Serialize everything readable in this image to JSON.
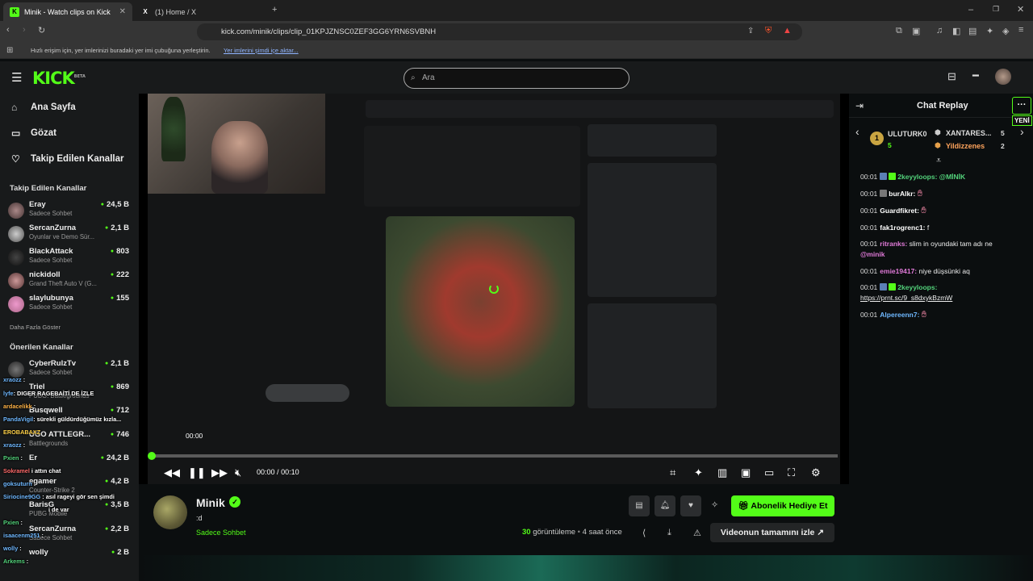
{
  "browser": {
    "tabs": [
      {
        "title": "Minik - Watch clips on Kick",
        "favicon": "K"
      },
      {
        "title": "(1) Home / X",
        "favicon": "X"
      }
    ],
    "url": "kick.com/minik/clips/clip_01KPJZNSC0ZEF3GG6YRN6SVBNH",
    "bookmark_hint": "Hızlı erişim için, yer imlerinizi buradaki yer imi çubuğuna yerleştirin.",
    "bookmark_link": "Yer imlerini şimdi içe aktar..."
  },
  "header": {
    "logo": "KICK",
    "logo_badge": "BETA",
    "search_placeholder": "Ara"
  },
  "sidebar": {
    "nav": [
      {
        "label": "Ana Sayfa",
        "icon": "home-icon"
      },
      {
        "label": "Gözat",
        "icon": "browse-icon"
      },
      {
        "label": "Takip Edilen Kanallar",
        "icon": "heart-icon"
      }
    ],
    "followed_header": "Takip Edilen Kanallar",
    "followed": [
      {
        "name": "Eray",
        "sub": "Sadece Sohbet",
        "count": "24,5 B"
      },
      {
        "name": "SercanZurna",
        "sub": "Oyunlar ve Demo Sür...",
        "count": "2,1 B"
      },
      {
        "name": "BlackAttack",
        "sub": "Sadece Sohbet",
        "count": "803"
      },
      {
        "name": "nickidoll",
        "sub": "Grand Theft Auto V (G...",
        "count": "222"
      },
      {
        "name": "slaylubunya",
        "sub": "Sadece Sohbet",
        "count": "155"
      }
    ],
    "show_more": "Daha Fazla Göster",
    "recommended_header": "Önerilen Kanallar",
    "recommended": [
      {
        "name": "CyberRulzTv",
        "sub": "Sadece Sohbet",
        "count": "2,1 B"
      },
      {
        "name": "Triel",
        "sub": "PUBG: Battlegrounds",
        "count": "869"
      },
      {
        "name": "Busqwell",
        "sub": "",
        "count": "712"
      },
      {
        "name": "UGO ATTLEGR...",
        "sub": "Battlegrounds",
        "count": "746"
      },
      {
        "name": "Er",
        "sub": "",
        "count": "24,2 B"
      },
      {
        "name": "egamer",
        "sub": "Counter-Strike 2",
        "count": "4,2 B"
      },
      {
        "name": "BarisG",
        "sub": "PUBG Mobile",
        "count": "3,5 B"
      },
      {
        "name": "SercanZurna",
        "sub": "Sadece Sohbet",
        "count": "2,2 B"
      },
      {
        "name": "wolly",
        "sub": "",
        "count": "2 B"
      }
    ]
  },
  "overlay_chat": [
    {
      "user": "xraozz",
      "text": ""
    },
    {
      "user": "lyfe",
      "text": "DIGER RAGEBAİTİ DE İZLE"
    },
    {
      "user": "ardacelikk",
      "text": ""
    },
    {
      "user": "PandaVigil",
      "text": "sürekli güldürdüğümüz kızla..."
    },
    {
      "user": "EROBABAXZ",
      "text": ""
    },
    {
      "user": "xraozz",
      "text": ""
    },
    {
      "user": "Pxien",
      "text": ""
    },
    {
      "user": "Sokramel",
      "text": "i attın chat"
    },
    {
      "user": "goksuturn",
      "text": ""
    },
    {
      "user": "Siriocine9GG",
      "text": "asıl rageyi gör sen şimdi"
    },
    {
      "user": "",
      "text": "i de var"
    },
    {
      "user": "Pxien",
      "text": ""
    },
    {
      "user": "isaacenm251",
      "text": ""
    },
    {
      "user": "wolly",
      "text": ""
    },
    {
      "user": "Arkems",
      "text": ""
    }
  ],
  "player": {
    "hover_time": "00:00",
    "current": "00:00",
    "separator": "/",
    "duration": "00:10",
    "progress_fraction": 0.0
  },
  "channel": {
    "name": "Minik",
    "clip_title": ":d",
    "category": "Sadece Sohbet",
    "gift_button": "Abonelik Hediye Et",
    "views_count": "30",
    "views_label": "görüntüleme",
    "time_ago": "4 saat önce",
    "full_video_button": "Videonun tamamını izle"
  },
  "chat": {
    "title": "Chat Replay",
    "menu": "···",
    "new_label": "YENİ",
    "leaderboard": [
      {
        "rank": "1",
        "name": "ULUTURK0",
        "count": "5"
      },
      {
        "name": "XANTARES...",
        "count": "5"
      },
      {
        "name": "Yildizzenes",
        "count": "2"
      }
    ],
    "messages": [
      {
        "time": "00:01",
        "user": "2keyyloops",
        "text": "@MİNİK",
        "color": "green"
      },
      {
        "time": "00:01",
        "user": "burAlkr",
        "text": "",
        "color": "white"
      },
      {
        "time": "00:01",
        "user": "Guardfikret",
        "text": "",
        "color": "white"
      },
      {
        "time": "00:01",
        "user": "fak1rogrenc1",
        "text": "f",
        "color": "white"
      },
      {
        "time": "00:01",
        "user": "ritranks",
        "text": "slim in oyundaki tam adı ne",
        "mention": "@minik",
        "color": "pink"
      },
      {
        "time": "00:01",
        "user": "emie19417",
        "text": "niye düşsünki aq",
        "color": "pink"
      },
      {
        "time": "00:01",
        "user": "2keyyloops",
        "text": "",
        "link": "https://prnt.sc/9_s8dxykBzmW",
        "color": "green"
      },
      {
        "time": "00:01",
        "user": "Alpereenn7",
        "text": "",
        "color": "blue"
      }
    ]
  },
  "colors": {
    "accent": "#53fc18",
    "background": "#0b0e0f",
    "panel": "#181a1b"
  }
}
